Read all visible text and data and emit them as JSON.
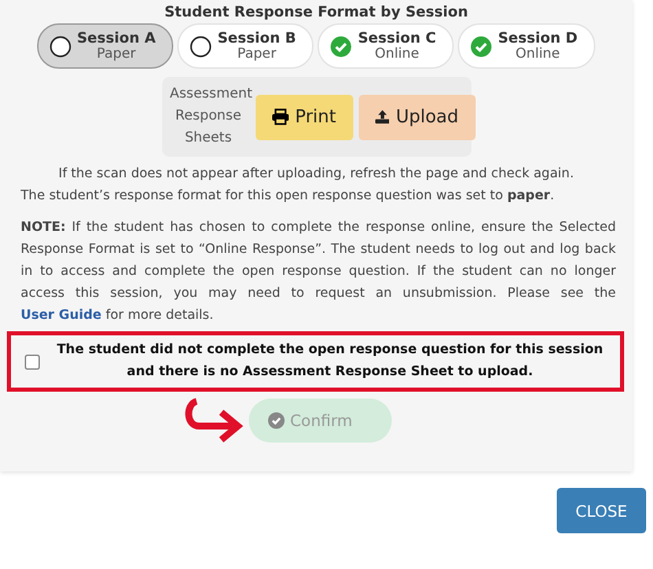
{
  "heading": "Student Response Format by Session",
  "sessions": [
    {
      "name": "Session A",
      "format": "Paper",
      "kind": "paper",
      "selected": true
    },
    {
      "name": "Session B",
      "format": "Paper",
      "kind": "paper",
      "selected": false
    },
    {
      "name": "Session C",
      "format": "Online",
      "kind": "online",
      "selected": false
    },
    {
      "name": "Session D",
      "format": "Online",
      "kind": "online",
      "selected": false
    }
  ],
  "sheets": {
    "label": "Assessment Response Sheets",
    "buttons": [
      {
        "label": "Print",
        "kind": "print"
      },
      {
        "label": "Upload",
        "kind": "upload"
      }
    ]
  },
  "scan_hint": "If the scan does not appear after uploading, refresh the page and check again.",
  "format_notice": "The student’s response format for this open response question was set to **paper**.",
  "note": {
    "before": "**NOTE:** If the student has chosen to complete the response online, ensure the Selected Response Format is set to “Online Response”. The student needs to log out and log back in to access and complete the open response question. If the student can no longer access this session, you may need to request an unsubmission. Please see the",
    "link": "User Guide",
    "after": "for more details."
  },
  "no_response": {
    "label": "The student did not complete the open response question for this session and there is no Assessment Response Sheet to upload.",
    "checked": false
  },
  "confirm": {
    "label": "Confirm",
    "disabled": true
  },
  "close": "CLOSE"
}
